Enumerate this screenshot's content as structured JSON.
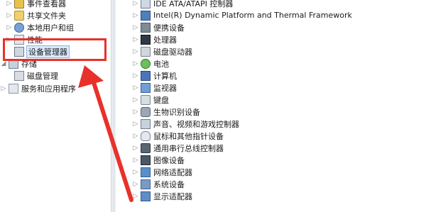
{
  "left_tree": {
    "items": [
      {
        "label": "事件查看器",
        "icon": "event-viewer-icon"
      },
      {
        "label": "共享文件夹",
        "icon": "shared-folder-icon"
      },
      {
        "label": "本地用户和组",
        "icon": "local-users-icon"
      },
      {
        "label": "性能",
        "icon": "performance-icon"
      },
      {
        "label": "设备管理器",
        "icon": "device-manager-icon",
        "selected": true
      },
      {
        "label": "存储",
        "icon": "storage-icon"
      },
      {
        "label": "磁盘管理",
        "icon": "disk-management-icon"
      },
      {
        "label": "服务和应用程序",
        "icon": "services-icon"
      }
    ]
  },
  "device_tree": {
    "items": [
      {
        "label": "IDE ATA/ATAPI 控制器",
        "icon": "ide-controller-icon"
      },
      {
        "label": "Intel(R) Dynamic Platform and Thermal Framework",
        "icon": "intel-icon"
      },
      {
        "label": "便携设备",
        "icon": "portable-device-icon"
      },
      {
        "label": "处理器",
        "icon": "processor-icon"
      },
      {
        "label": "磁盘驱动器",
        "icon": "disk-drive-icon"
      },
      {
        "label": "电池",
        "icon": "battery-icon"
      },
      {
        "label": "计算机",
        "icon": "computer-icon"
      },
      {
        "label": "监视器",
        "icon": "monitor-icon"
      },
      {
        "label": "键盘",
        "icon": "keyboard-icon"
      },
      {
        "label": "生物识别设备",
        "icon": "biometric-icon"
      },
      {
        "label": "声音、视频和游戏控制器",
        "icon": "audio-icon"
      },
      {
        "label": "鼠标和其他指针设备",
        "icon": "mouse-icon"
      },
      {
        "label": "通用串行总线控制器",
        "icon": "usb-icon"
      },
      {
        "label": "图像设备",
        "icon": "imaging-icon"
      },
      {
        "label": "网络适配器",
        "icon": "network-adapter-icon"
      },
      {
        "label": "系统设备",
        "icon": "system-device-icon"
      },
      {
        "label": "显示适配器",
        "icon": "display-adapter-icon"
      }
    ]
  },
  "annotation": {
    "color": "#e8312a"
  }
}
